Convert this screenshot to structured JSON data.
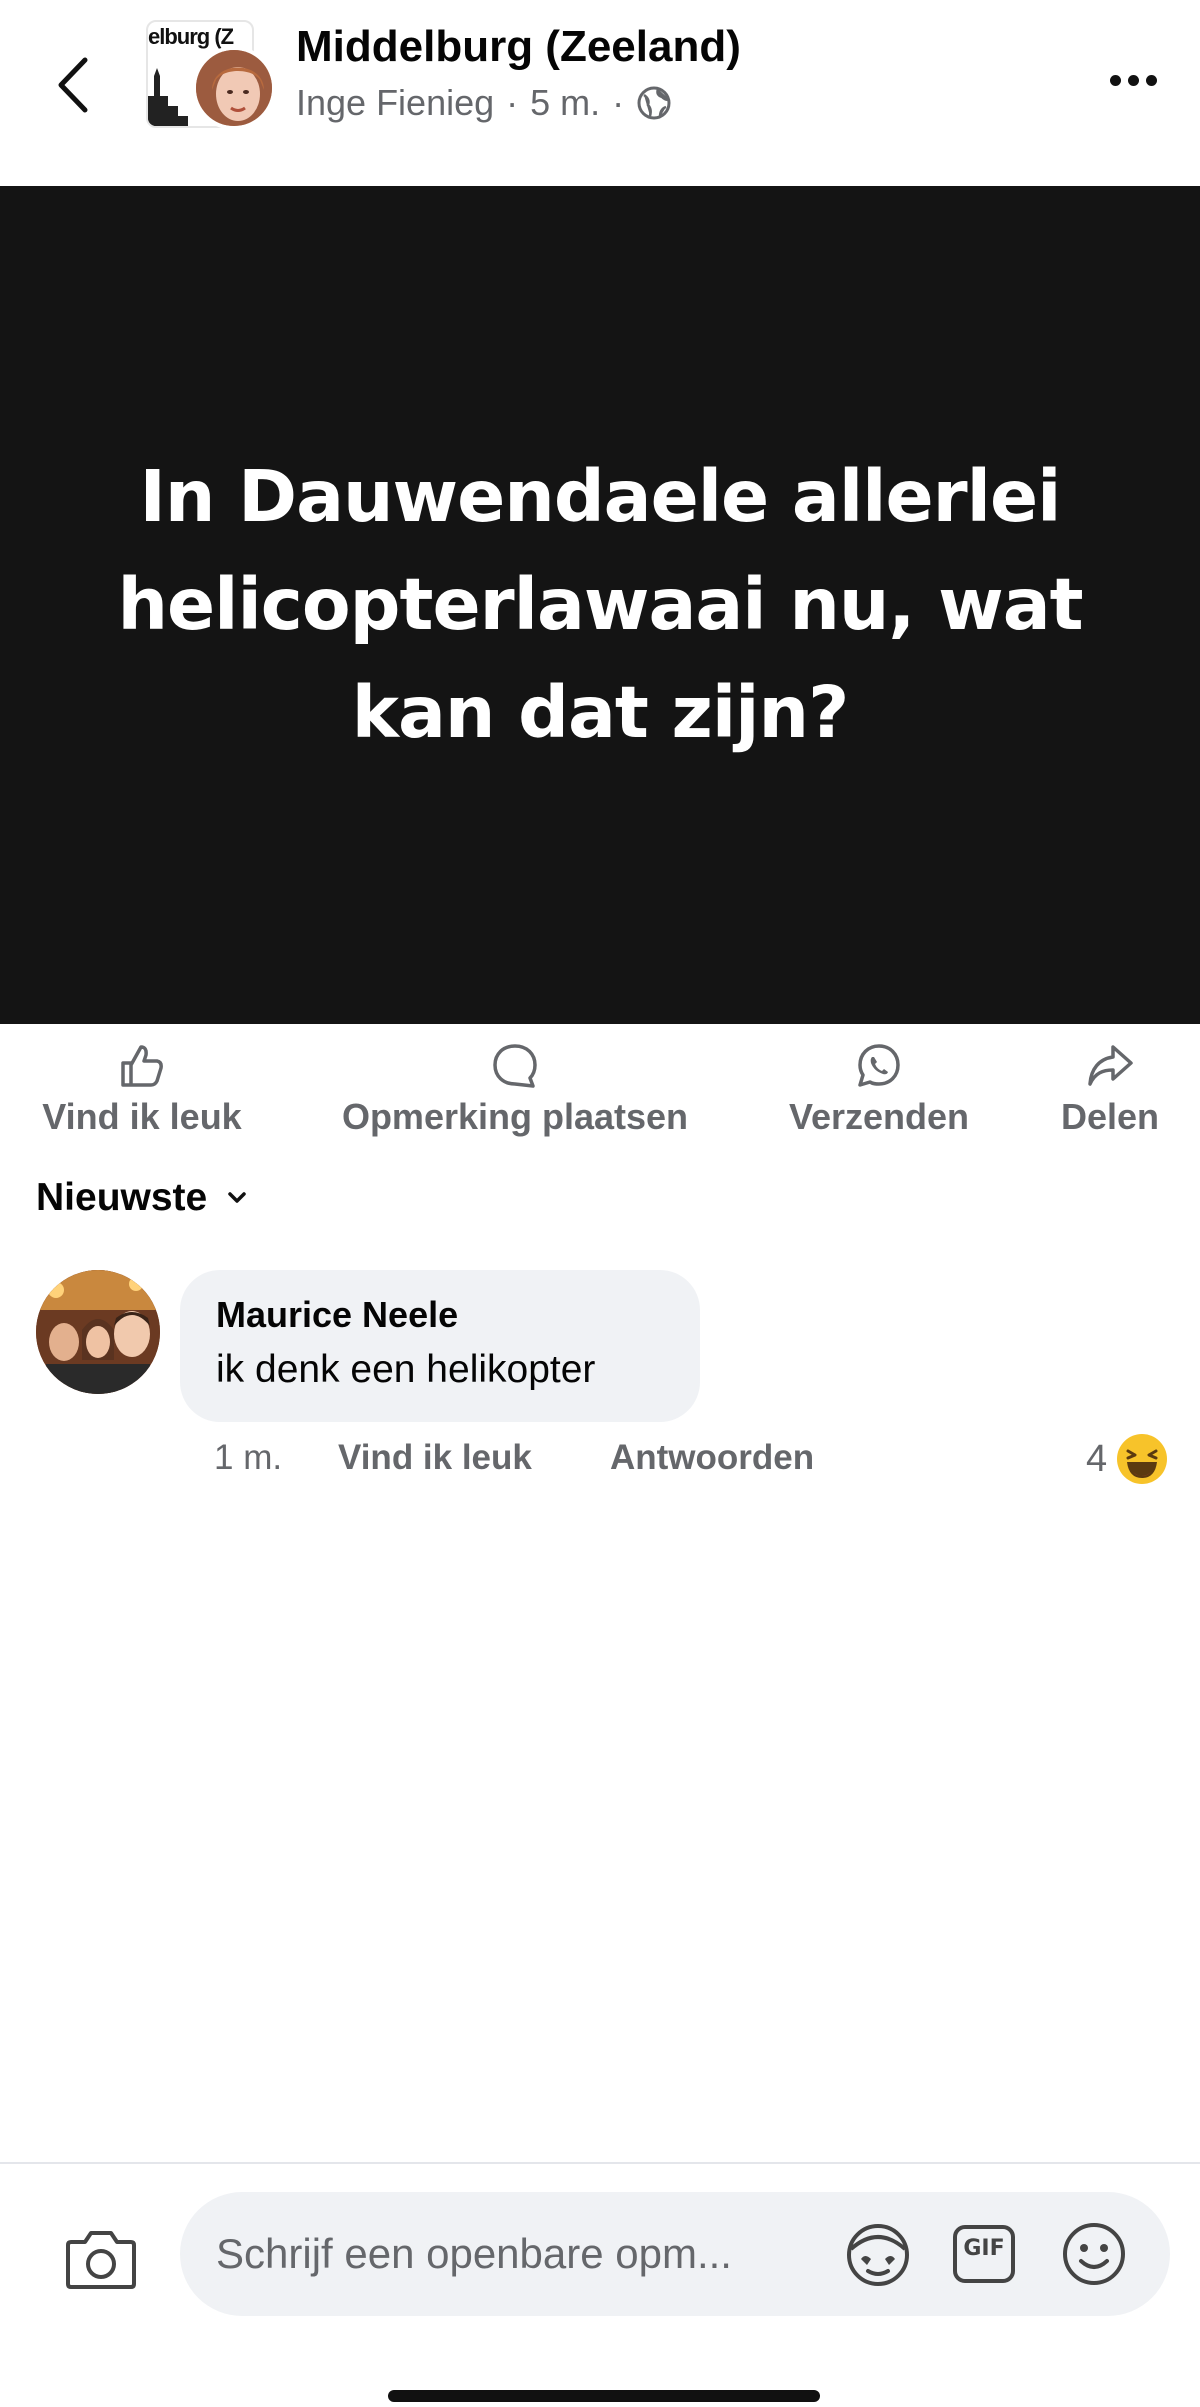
{
  "header": {
    "group_name": "Middelburg (Zeeland)",
    "group_logo_text": "elburg (Z",
    "author": "Inge Fienieg",
    "separator": "·",
    "time": "5 m.",
    "audience_icon": "globe-icon"
  },
  "post": {
    "text": "In Dauwendaele allerlei helicopterlawaai nu, wat kan dat zijn?",
    "background_color": "#141414"
  },
  "actions": [
    {
      "label": "Vind ik leuk",
      "icon": "thumbs-up-icon"
    },
    {
      "label": "Opmerking plaatsen",
      "icon": "comment-icon"
    },
    {
      "label": "Verzenden",
      "icon": "whatsapp-icon"
    },
    {
      "label": "Delen",
      "icon": "share-icon"
    }
  ],
  "sort": {
    "label": "Nieuwste"
  },
  "comment": {
    "author": "Maurice Neele",
    "text": "ik denk een helikopter",
    "time": "1 m.",
    "like_label": "Vind ik leuk",
    "reply_label": "Antwoorden",
    "reaction_count": "4",
    "reaction_icon": "laughing-emoji-icon"
  },
  "composer": {
    "placeholder": "Schrijf een openbare opm...",
    "gif_label": "GIF"
  },
  "colors": {
    "secondary_text": "#65676b",
    "bubble": "#f0f2f5",
    "primary_text": "#050505"
  }
}
